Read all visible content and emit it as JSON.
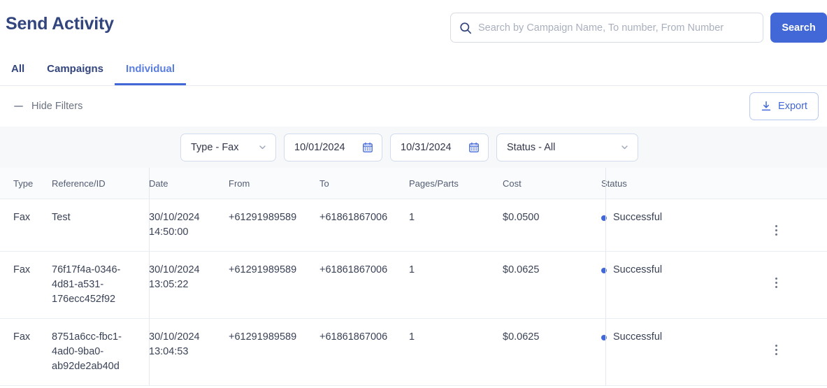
{
  "header": {
    "title": "Send Activity",
    "search": {
      "placeholder": "Search by Campaign Name, To number, From Number",
      "value": "",
      "icon": "search-icon",
      "button_label": "Search"
    }
  },
  "tabs": [
    {
      "label": "All",
      "active": false
    },
    {
      "label": "Campaigns",
      "active": false
    },
    {
      "label": "Individual",
      "active": true
    }
  ],
  "toolbar": {
    "hide_filters_label": "Hide Filters",
    "collapse_icon": "minus-icon",
    "export_label": "Export",
    "export_icon": "download-icon"
  },
  "filters": {
    "type": {
      "label": "Type - Fax",
      "icon": "chevron-down-icon"
    },
    "date_from": {
      "value": "10/01/2024",
      "icon": "calendar-icon"
    },
    "date_to": {
      "value": "10/31/2024",
      "icon": "calendar-icon"
    },
    "status": {
      "label": "Status - All",
      "icon": "chevron-down-icon"
    }
  },
  "table": {
    "columns": [
      "Type",
      "Reference/ID",
      "Date",
      "From",
      "To",
      "Pages/Parts",
      "Cost",
      "Status"
    ],
    "rows": [
      {
        "type": "Fax",
        "reference": "Test",
        "date": "30/10/2024 14:50:00",
        "from": "+61291989589",
        "to": "+61861867006",
        "pages": "1",
        "cost": "$0.0500",
        "status": "Successful",
        "menu_icon": "kebab-menu-icon"
      },
      {
        "type": "Fax",
        "reference": "76f17f4a-0346-4d81-a531-176ecc452f92",
        "date": "30/10/2024 13:05:22",
        "from": "+61291989589",
        "to": "+61861867006",
        "pages": "1",
        "cost": "$0.0625",
        "status": "Successful",
        "menu_icon": "kebab-menu-icon"
      },
      {
        "type": "Fax",
        "reference": "8751a6cc-fbc1-4ad0-9ba0-ab92de2ab40d",
        "date": "30/10/2024 13:04:53",
        "from": "+61291989589",
        "to": "+61861867006",
        "pages": "1",
        "cost": "$0.0625",
        "status": "Successful",
        "menu_icon": "kebab-menu-icon"
      }
    ]
  },
  "colors": {
    "brand_blue": "#4268d8",
    "title_navy": "#33457d",
    "tab_active": "#5a7de0",
    "status_dot": "#4268d8",
    "filter_strip_bg": "#f7f8fa",
    "table_head_bg": "#fafbfc",
    "border": "#e9ecf1"
  }
}
